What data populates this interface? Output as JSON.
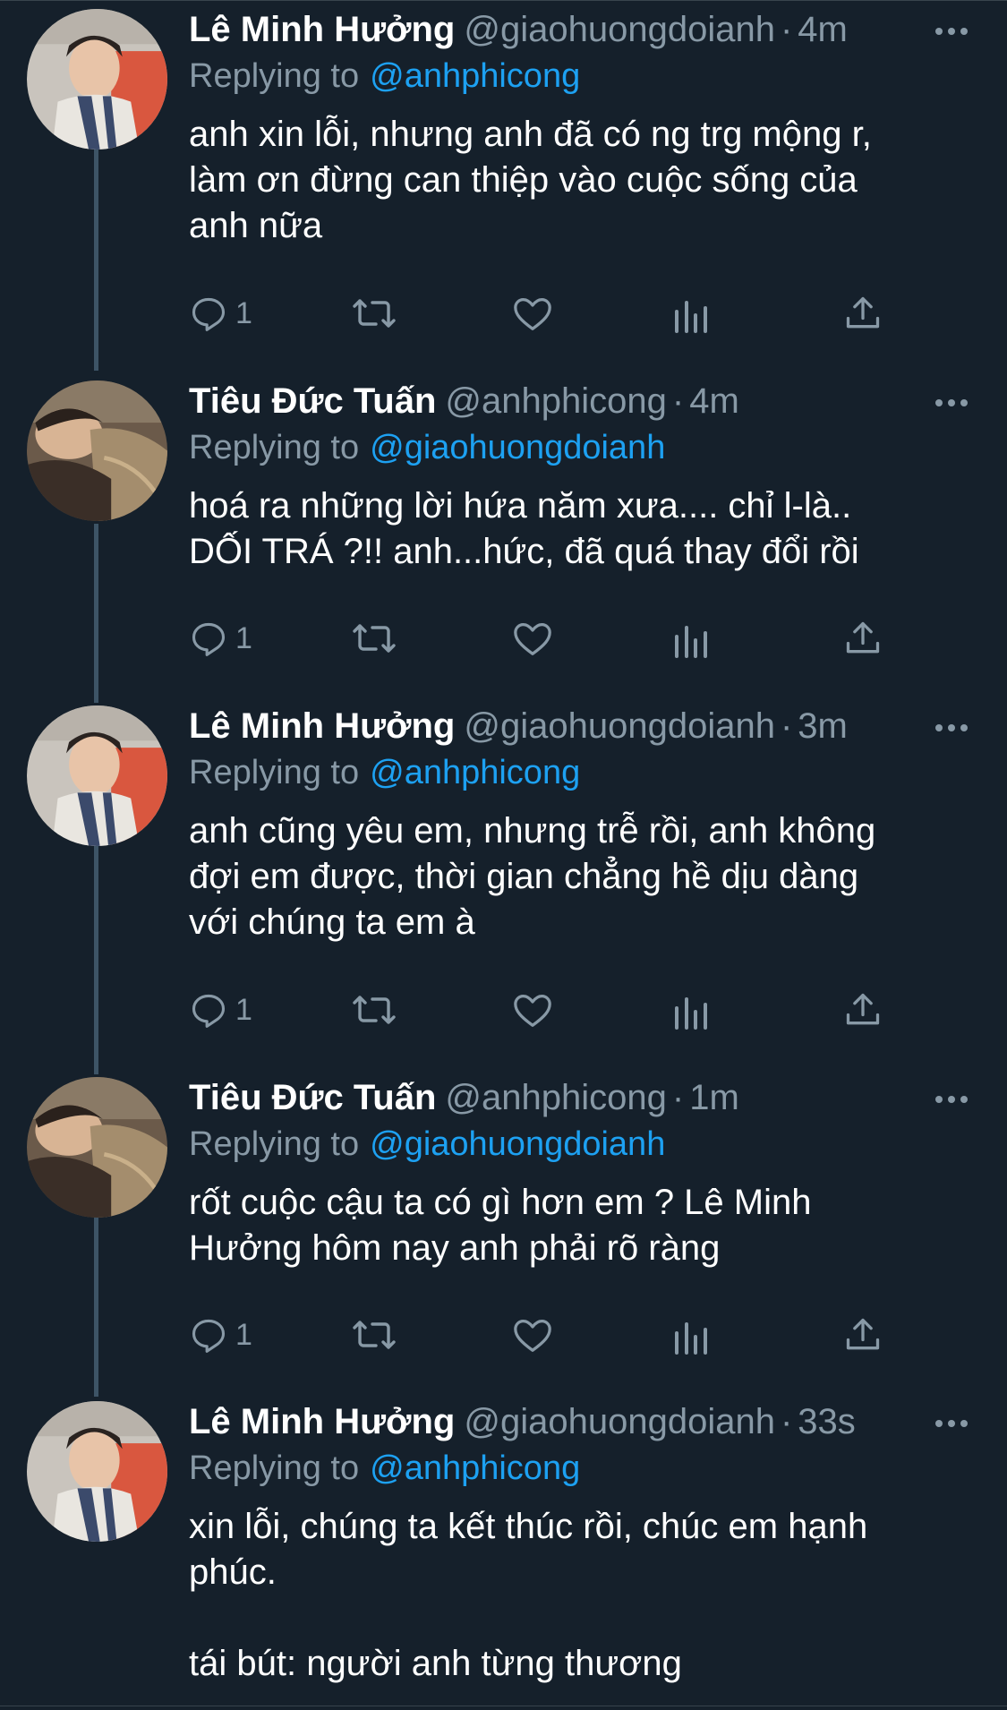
{
  "colors": {
    "background": "#15202b",
    "text": "#ffffff",
    "muted": "#8899a6",
    "link": "#1da1f2",
    "thread_line": "#3d5466"
  },
  "tweets": [
    {
      "name": "Lê Minh Hưởng",
      "handle": "@giaohuongdoianh",
      "time": "4m",
      "replying_label": "Replying to",
      "replying_to": "@anhphicong",
      "text": "anh xin lỗi, nhưng anh đã có ng trg mộng r,\nlàm ơn đừng can thiệp vào cuộc sống của\nanh nữa",
      "reply_count": "1",
      "avatar_icon": "profile-photo-man-scarf"
    },
    {
      "name": "Tiêu Đức Tuấn",
      "handle": "@anhphicong",
      "time": "4m",
      "replying_label": "Replying to",
      "replying_to": "@giaohuongdoianh",
      "text": "hoá ra những lời hứa năm xưa.... chỉ l-là..\nDỐI TRÁ ?!! anh...hức, đã quá thay đổi rồi",
      "reply_count": "1",
      "avatar_icon": "profile-photo-sleeping"
    },
    {
      "name": "Lê Minh Hưởng",
      "handle": "@giaohuongdoianh",
      "time": "3m",
      "replying_label": "Replying to",
      "replying_to": "@anhphicong",
      "text": "anh cũng yêu em, nhưng trễ rồi, anh không\nđợi em được, thời gian chẳng hề dịu dàng\nvới chúng ta em à",
      "reply_count": "1",
      "avatar_icon": "profile-photo-man-scarf"
    },
    {
      "name": "Tiêu Đức Tuấn",
      "handle": "@anhphicong",
      "time": "1m",
      "replying_label": "Replying to",
      "replying_to": "@giaohuongdoianh",
      "text": "rốt cuộc cậu ta có gì hơn em ? Lê Minh\nHưởng hôm nay anh phải rõ ràng",
      "reply_count": "1",
      "avatar_icon": "profile-photo-sleeping"
    },
    {
      "name": "Lê Minh Hưởng",
      "handle": "@giaohuongdoianh",
      "time": "33s",
      "replying_label": "Replying to",
      "replying_to": "@anhphicong",
      "text": "xin lỗi, chúng ta kết thúc rồi, chúc em hạnh\nphúc.\n\ntái bút: người anh từng thương",
      "reply_count": "",
      "avatar_icon": "profile-photo-man-scarf"
    }
  ]
}
